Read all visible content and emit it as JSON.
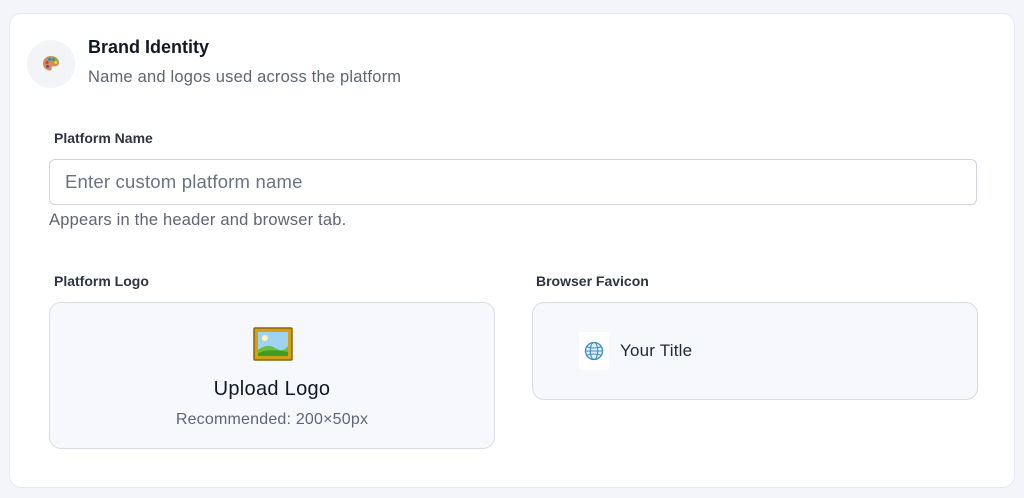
{
  "header": {
    "icon": "palette-icon",
    "title": "Brand Identity",
    "subtitle": "Name and logos used across the platform"
  },
  "platform_name": {
    "label": "Platform Name",
    "value": "",
    "placeholder": "Enter custom platform name",
    "help": "Appears in the header and browser tab."
  },
  "platform_logo": {
    "label": "Platform Logo",
    "icon": "framed-picture-icon",
    "upload_label": "Upload Logo",
    "recommendation": "Recommended: 200×50px"
  },
  "browser_favicon": {
    "label": "Browser Favicon",
    "icon": "globe-icon",
    "preview_title": "Your Title"
  },
  "colors": {
    "page_bg": "#f4f5fa",
    "card_bg": "#ffffff",
    "box_bg": "#f7f8fb",
    "border": "#d8dce3",
    "muted_text": "#5f6572"
  }
}
